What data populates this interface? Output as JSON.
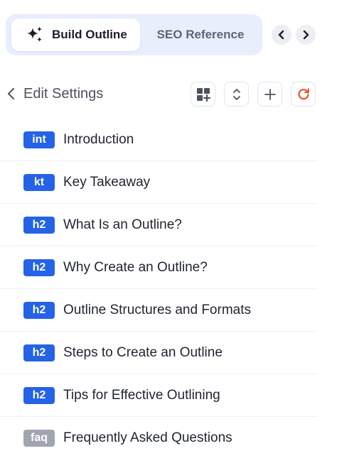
{
  "tabs": [
    {
      "label": "Build Outline",
      "icon": "sparkle-icon",
      "active": true
    },
    {
      "label": "SEO Reference",
      "active": false
    }
  ],
  "header": {
    "back_label": "Edit Settings"
  },
  "colors": {
    "tag_blue": "#2563e6",
    "tag_gray": "#a1a5af",
    "refresh_orange": "#e8532c",
    "tab_bar_bg": "#e8eefc"
  },
  "outline": [
    {
      "tag": "int",
      "title": "Introduction"
    },
    {
      "tag": "kt",
      "title": "Key Takeaway"
    },
    {
      "tag": "h2",
      "title": "What Is an Outline?"
    },
    {
      "tag": "h2",
      "title": "Why Create an Outline?"
    },
    {
      "tag": "h2",
      "title": "Outline Structures and Formats"
    },
    {
      "tag": "h2",
      "title": "Steps to Create an Outline"
    },
    {
      "tag": "h2",
      "title": "Tips for Effective Outlining"
    },
    {
      "tag": "faq",
      "title": "Frequently Asked Questions"
    }
  ]
}
